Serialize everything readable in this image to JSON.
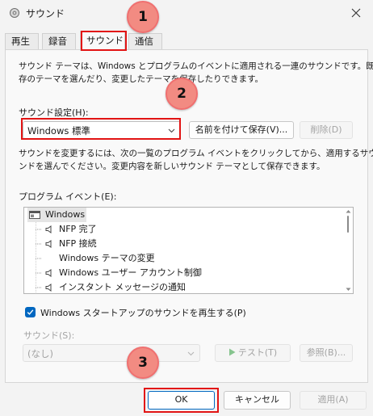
{
  "window": {
    "title": "サウンド"
  },
  "tabs": [
    "再生",
    "録音",
    "サウンド",
    "通信"
  ],
  "callouts": [
    "1",
    "2",
    "3"
  ],
  "sounds": {
    "description": [
      "サウンド テーマは、Windows とプログラムのイベントに適用される一連のサウンドです。既",
      "存のテーマを選んだり、変更したテーマを保存したりできます。"
    ],
    "scheme_label": "サウンド設定(H):",
    "scheme_value": "Windows 標準",
    "save_as_label": "名前を付けて保存(V)...",
    "delete_label": "削除(D)",
    "change_description": [
      "サウンドを変更するには、次の一覧のプログラム イベントをクリックしてから、適用するサウ",
      "ンドを選んでください。変更内容を新しいサウンド テーマとして保存できます。"
    ],
    "events_label": "プログラム イベント(E):",
    "events": [
      {
        "label": "Windows",
        "kind": "group",
        "has_sound": false
      },
      {
        "label": "NFP 完了",
        "kind": "item",
        "has_sound": true
      },
      {
        "label": "NFP 接続",
        "kind": "item",
        "has_sound": true
      },
      {
        "label": "Windows テーマの変更",
        "kind": "item",
        "has_sound": false
      },
      {
        "label": "Windows ユーザー アカウント制御",
        "kind": "item",
        "has_sound": true
      },
      {
        "label": "インスタント メッセージの通知",
        "kind": "item",
        "has_sound": true
      }
    ],
    "startup_label": "Windows スタートアップのサウンドを再生する(P)",
    "startup_checked": true,
    "sound_label": "サウンド(S):",
    "sound_value": "(なし)",
    "test_label": "テスト(T)",
    "browse_label": "参照(B)..."
  },
  "footer": {
    "ok_label": "OK",
    "cancel_label": "キャンセル",
    "apply_label": "適用(A)"
  },
  "colors": {
    "accent": "#0067c0",
    "highlight_red": "#e21414",
    "callout_fill": "#f28b82"
  }
}
